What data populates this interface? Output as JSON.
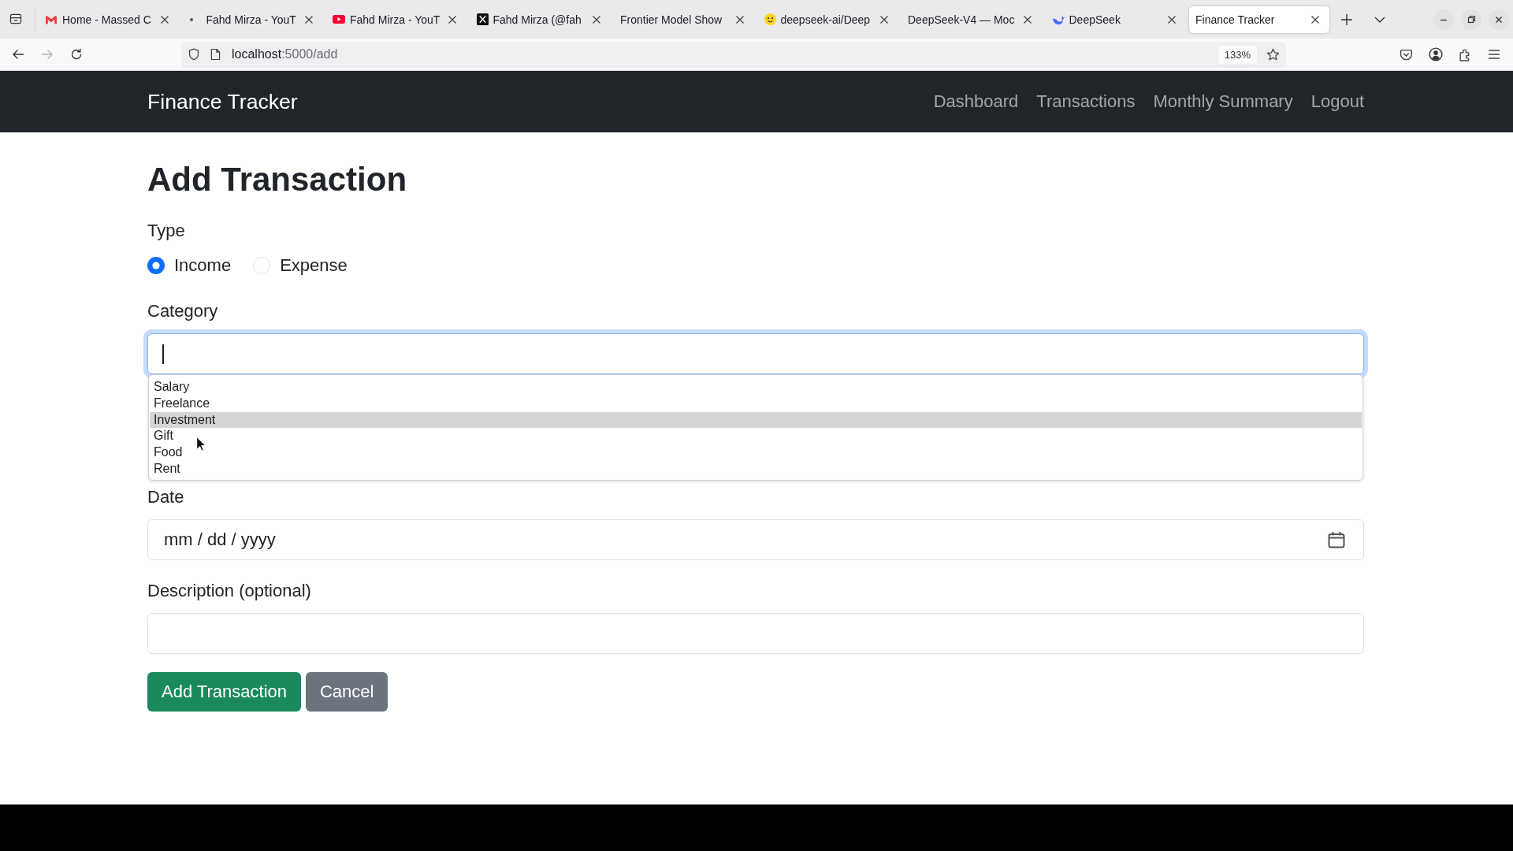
{
  "browser": {
    "tabs": [
      {
        "title": "Home - Massed C",
        "kind": "mail",
        "selected": false
      },
      {
        "title": "Fahd Mirza - YouT",
        "kind": "dot",
        "selected": false
      },
      {
        "title": "Fahd Mirza - YouT",
        "kind": "video",
        "selected": false
      },
      {
        "title": "Fahd Mirza (@fah",
        "kind": "x",
        "selected": false
      },
      {
        "title": "Frontier Model Show",
        "kind": "plain",
        "selected": false
      },
      {
        "title": "deepseek-ai/Deep",
        "kind": "face",
        "selected": false
      },
      {
        "title": "DeepSeek-V4 — Moc",
        "kind": "plain",
        "selected": false
      },
      {
        "title": "DeepSeek",
        "kind": "whale",
        "selected": false
      },
      {
        "title": "Finance Tracker",
        "kind": "plain",
        "selected": true
      }
    ],
    "forward_disabled": true,
    "address": {
      "host": "localhost",
      "path": ":5000/add"
    },
    "zoom": "133%"
  },
  "navbar": {
    "brand": "Finance Tracker",
    "links": [
      "Dashboard",
      "Transactions",
      "Monthly Summary",
      "Logout"
    ]
  },
  "form": {
    "heading": "Add Transaction",
    "type": {
      "label": "Type",
      "options": [
        {
          "label": "Income",
          "selected": true
        },
        {
          "label": "Expense",
          "selected": false
        }
      ]
    },
    "category": {
      "label": "Category",
      "focused": true,
      "suggestions": [
        {
          "label": "Salary",
          "selected": false
        },
        {
          "label": "Freelance",
          "selected": false
        },
        {
          "label": "Investment",
          "selected": true
        },
        {
          "label": "Gift",
          "selected": false
        },
        {
          "label": "Food",
          "selected": false
        },
        {
          "label": "Rent",
          "selected": false
        }
      ]
    },
    "date": {
      "label": "Date",
      "placeholder": "mm / dd / yyyy"
    },
    "description": {
      "label": "Description (optional)"
    },
    "buttons": [
      {
        "label": "Add Transaction",
        "kind": "primary"
      },
      {
        "label": "Cancel",
        "kind": "secondary"
      }
    ]
  }
}
